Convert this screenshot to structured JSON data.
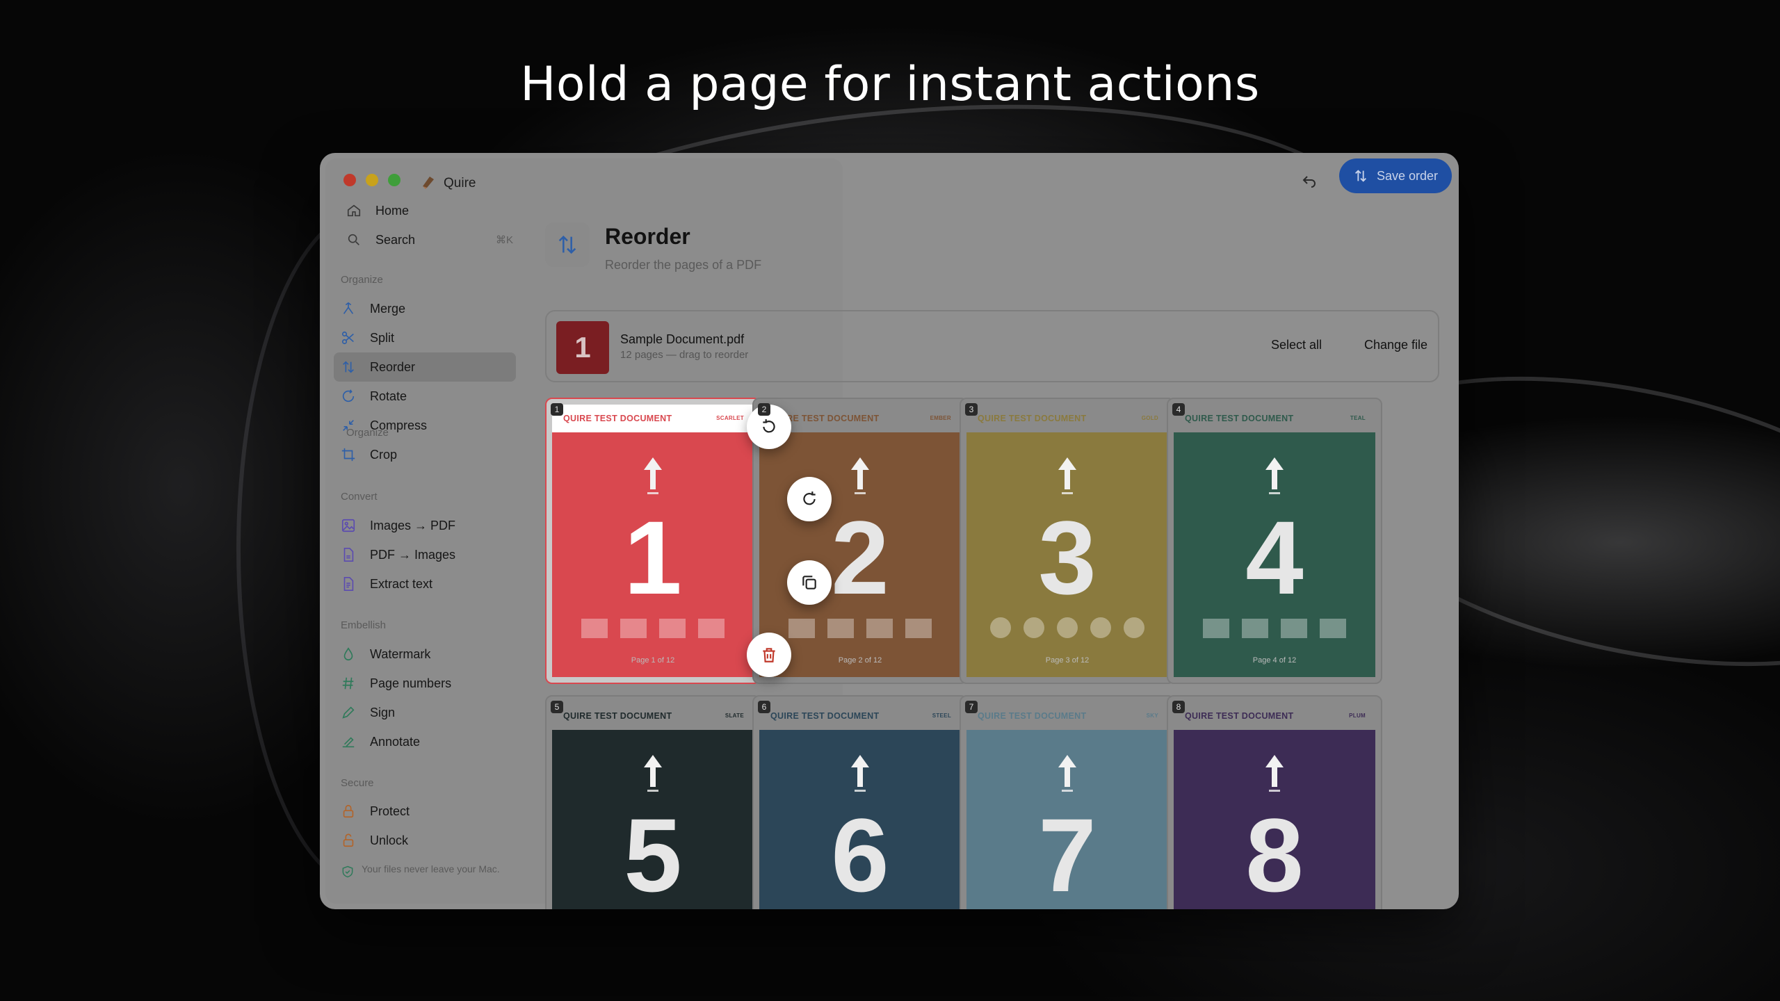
{
  "headline": "Hold a page for instant actions",
  "app": {
    "name": "Quire"
  },
  "sidebar": {
    "home": "Home",
    "search": "Search",
    "search_shortcut": "⌘K",
    "sections": {
      "organize": "Organize",
      "convert": "Convert",
      "embellish": "Embellish",
      "secure": "Secure"
    },
    "organize_items": [
      "Merge",
      "Split",
      "Reorder",
      "Rotate",
      "Compress",
      "Crop"
    ],
    "convert_items": [
      "Images → PDF",
      "PDF → Images",
      "Extract text"
    ],
    "embellish_items": [
      "Watermark",
      "Page numbers",
      "Sign",
      "Annotate"
    ],
    "secure_items": [
      "Protect",
      "Unlock"
    ],
    "active_item": "Reorder",
    "privacy_note": "Your files never leave your Mac."
  },
  "toolbar": {
    "save_label": "Save order"
  },
  "tool": {
    "title": "Reorder",
    "subtitle": "Reorder the pages of a PDF"
  },
  "file": {
    "name": "Sample Document.pdf",
    "meta": "12 pages — drag to reorder",
    "thumb_number": "1",
    "select_all": "Select all",
    "change_file": "Change file"
  },
  "pages": [
    {
      "index": "1",
      "number": "1",
      "header": "QUIRE TEST DOCUMENT",
      "tag": "SCARLET",
      "footer": "Page 1 of 12",
      "color": "#d9484f",
      "header_color": "#ffffff",
      "header_text": "#d9484f"
    },
    {
      "index": "2",
      "number": "2",
      "header": "QUIRE TEST DOCUMENT",
      "tag": "EMBER",
      "footer": "Page 2 of 12",
      "color": "#7d5436",
      "header_color": "#8a8a8a",
      "header_text": "#7d5436"
    },
    {
      "index": "3",
      "number": "3",
      "header": "QUIRE TEST DOCUMENT",
      "tag": "GOLD",
      "footer": "Page 3 of 12",
      "color": "#8a7a3e",
      "header_color": "#8a8a8a",
      "header_text": "#8a7a3e"
    },
    {
      "index": "4",
      "number": "4",
      "header": "QUIRE TEST DOCUMENT",
      "tag": "TEAL",
      "footer": "Page 4 of 12",
      "color": "#2f5a4c",
      "header_color": "#8a8a8a",
      "header_text": "#2f5a4c"
    },
    {
      "index": "5",
      "number": "5",
      "header": "QUIRE TEST DOCUMENT",
      "tag": "SLATE",
      "footer": "",
      "color": "#1f2a2c",
      "header_color": "#8a8a8a",
      "header_text": "#1f2a2c"
    },
    {
      "index": "6",
      "number": "6",
      "header": "QUIRE TEST DOCUMENT",
      "tag": "STEEL",
      "footer": "",
      "color": "#2c4658",
      "header_color": "#8a8a8a",
      "header_text": "#2c4658"
    },
    {
      "index": "7",
      "number": "7",
      "header": "QUIRE TEST DOCUMENT",
      "tag": "SKY",
      "footer": "",
      "color": "#5a7b8a",
      "header_color": "#8a8a8a",
      "header_text": "#5a7b8a"
    },
    {
      "index": "8",
      "number": "8",
      "header": "QUIRE TEST DOCUMENT",
      "tag": "PLUM",
      "footer": "",
      "color": "#3d2c55",
      "header_color": "#8a8a8a",
      "header_text": "#3d2c55"
    }
  ],
  "actions": [
    "rotate-left-icon",
    "rotate-right-icon",
    "duplicate-icon",
    "trash-icon"
  ]
}
